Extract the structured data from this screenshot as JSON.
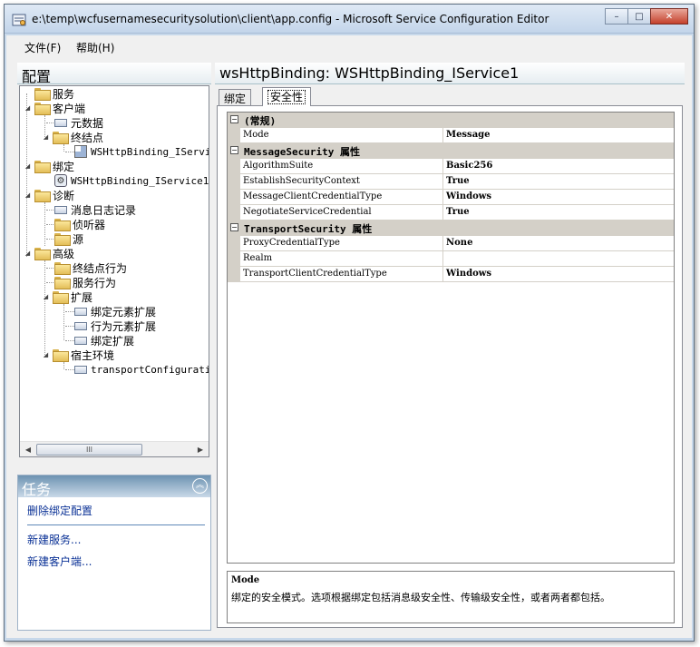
{
  "window": {
    "title": "e:\\temp\\wcfusernamesecuritysolution\\client\\app.config - Microsoft Service Configuration Editor",
    "minimize": "–",
    "maximize": "□",
    "close": "✕"
  },
  "menu": {
    "file": "文件(F)",
    "help": "帮助(H)"
  },
  "left_pane": {
    "header": "配置",
    "tree": [
      {
        "label": "服务"
      },
      {
        "label": "客户端"
      },
      {
        "label": "元数据"
      },
      {
        "label": "终结点"
      },
      {
        "label": "WSHttpBinding_IServic"
      },
      {
        "label": "绑定"
      },
      {
        "label": "WSHttpBinding_IService1"
      },
      {
        "label": "诊断"
      },
      {
        "label": "消息日志记录"
      },
      {
        "label": "侦听器"
      },
      {
        "label": "源"
      },
      {
        "label": "高级"
      },
      {
        "label": "终结点行为"
      },
      {
        "label": "服务行为"
      },
      {
        "label": "扩展"
      },
      {
        "label": "绑定元素扩展"
      },
      {
        "label": "行为元素扩展"
      },
      {
        "label": "绑定扩展"
      },
      {
        "label": "宿主环境"
      },
      {
        "label": "transportConfiguratio"
      }
    ],
    "scroll_thumb": "III"
  },
  "tasks": {
    "header": "任务",
    "links": [
      "删除绑定配置",
      "新建服务...",
      "新建客户端..."
    ]
  },
  "right_pane": {
    "header": "wsHttpBinding: WSHttpBinding_IService1",
    "tabs": [
      "绑定",
      "安全性"
    ],
    "active_tab": "安全性",
    "property_grid": {
      "categories": [
        {
          "name": "(常规)",
          "properties": [
            {
              "name": "Mode",
              "value": "Message"
            }
          ]
        },
        {
          "name": "MessageSecurity 属性",
          "properties": [
            {
              "name": "AlgorithmSuite",
              "value": "Basic256"
            },
            {
              "name": "EstablishSecurityContext",
              "value": "True"
            },
            {
              "name": "MessageClientCredentialType",
              "value": "Windows"
            },
            {
              "name": "NegotiateServiceCredential",
              "value": "True"
            }
          ]
        },
        {
          "name": "TransportSecurity 属性",
          "properties": [
            {
              "name": "ProxyCredentialType",
              "value": "None"
            },
            {
              "name": "Realm",
              "value": ""
            },
            {
              "name": "TransportClientCredentialType",
              "value": "Windows"
            }
          ]
        }
      ]
    },
    "description": {
      "title": "Mode",
      "text": "绑定的安全模式。选项根据绑定包括消息级安全性、传输级安全性，或者两者都包括。"
    }
  },
  "colors": {
    "title_bar": "#c3d5ea",
    "pane_header_gradient_end": "#e6edf1",
    "task_link": "#0b3296",
    "category_row": "#d4d0c8",
    "close_button": "#c4412c"
  }
}
